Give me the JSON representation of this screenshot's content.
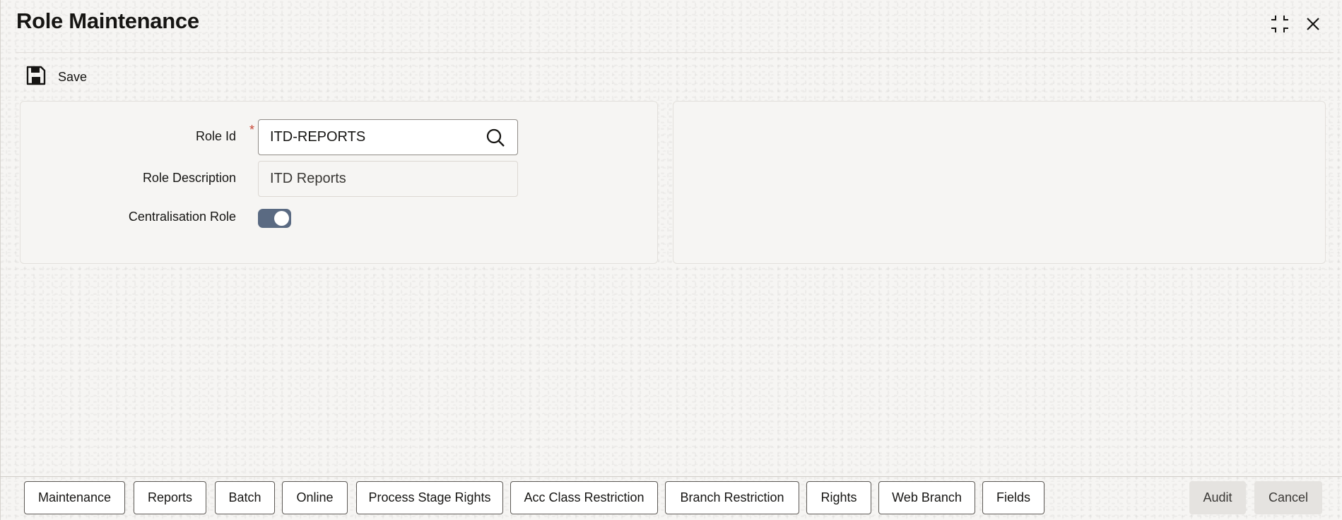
{
  "header": {
    "title": "Role Maintenance",
    "icons": [
      "collapse-icon",
      "close-icon"
    ]
  },
  "toolbar": {
    "save_label": "Save",
    "save_icon": "floppy-disk-icon"
  },
  "form": {
    "role_id": {
      "label": "Role Id",
      "required_mark": "*",
      "value": "ITD-REPORTS",
      "icon": "search-icon"
    },
    "role_description": {
      "label": "Role Description",
      "value": "ITD Reports"
    },
    "centralisation_role": {
      "label": "Centralisation Role",
      "checked": true
    }
  },
  "footer": {
    "tabs": [
      {
        "label": "Maintenance"
      },
      {
        "label": "Reports"
      },
      {
        "label": "Batch"
      },
      {
        "label": "Online"
      },
      {
        "label": "Process Stage Rights"
      },
      {
        "label": "Acc Class Restriction"
      },
      {
        "label": "Branch Restriction"
      },
      {
        "label": "Rights"
      },
      {
        "label": "Web Branch"
      },
      {
        "label": "Fields"
      }
    ],
    "audit_label": "Audit",
    "cancel_label": "Cancel"
  },
  "colors": {
    "toggle_on": "#5a6a82",
    "required": "#c74634",
    "background": "#f6f5f3"
  }
}
